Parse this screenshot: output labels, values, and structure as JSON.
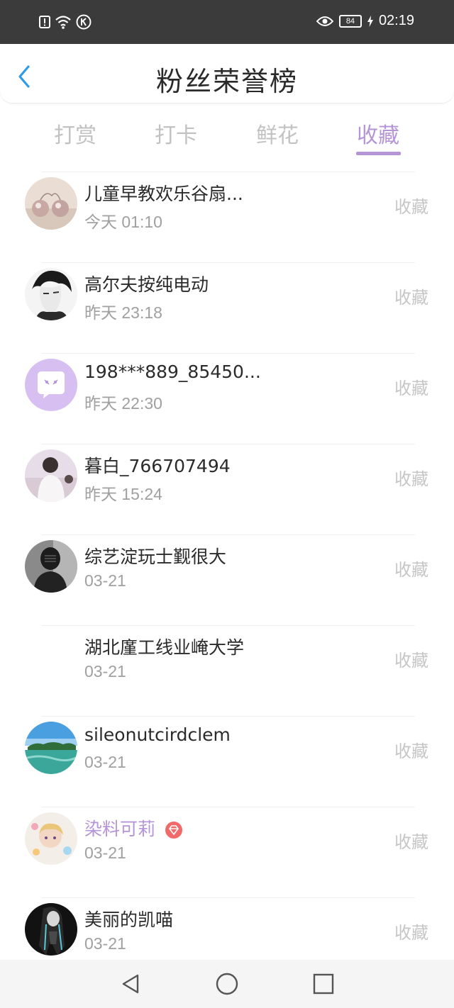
{
  "status_bar": {
    "battery": "84",
    "time": "02:19",
    "icons": [
      "alert-icon",
      "wifi-icon",
      "k-icon",
      "eye-icon",
      "battery-icon",
      "charging-icon"
    ]
  },
  "header": {
    "title": "粉丝荣誉榜",
    "back_icon": "chevron-left-icon"
  },
  "tabs": [
    {
      "label": "打赏"
    },
    {
      "label": "打卡"
    },
    {
      "label": "鲜花"
    },
    {
      "label": "收藏"
    }
  ],
  "active_tab": "收藏",
  "accent_color": "#b694d8",
  "fans": [
    {
      "name": "儿童早教欢乐谷扇...",
      "time": "今天 01:10",
      "action": "收藏",
      "avatar": "pearl-earring-photo"
    },
    {
      "name": "高尔夫按纯电动",
      "time": "昨天 23:18",
      "action": "收藏",
      "avatar": "sketch-boy-photo"
    },
    {
      "name": "198***889_85450...",
      "time": "昨天 22:30",
      "action": "收藏",
      "avatar": "chat-bubble-default-avatar"
    },
    {
      "name": "暮白_766707494",
      "time": "昨天 15:24",
      "action": "收藏",
      "avatar": "boy-back-photo"
    },
    {
      "name": "综艺淀玩士觐很大",
      "time": "03-21",
      "action": "收藏",
      "avatar": "masked-figure-photo"
    },
    {
      "name": "湖北廑工线业崦大学",
      "time": "03-21",
      "action": "收藏",
      "avatar": ""
    },
    {
      "name": "sileonutcirdclem",
      "time": "03-21",
      "action": "收藏",
      "avatar": "island-photo"
    },
    {
      "name": "染料可莉",
      "time": "03-21",
      "action": "收藏",
      "avatar": "anime-girl-photo",
      "vip": true
    },
    {
      "name": "美丽的凯喵",
      "time": "03-21",
      "action": "收藏",
      "avatar": "dark-anime-photo"
    }
  ],
  "nav_bar": [
    "back-triangle-icon",
    "home-circle-icon",
    "recents-square-icon"
  ]
}
